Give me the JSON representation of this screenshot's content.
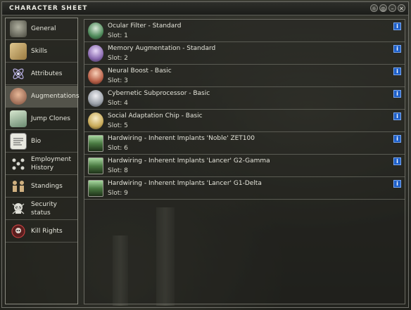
{
  "window": {
    "title": "CHARACTER SHEET",
    "buttons": [
      "☼",
      "◎",
      "–",
      "✕"
    ]
  },
  "sidebar": {
    "items": [
      {
        "label": "General",
        "icon": "portrait-icon"
      },
      {
        "label": "Skills",
        "icon": "scroll-icon"
      },
      {
        "label": "Attributes",
        "icon": "atom-icon"
      },
      {
        "label": "Augmentations",
        "icon": "implant-head-icon",
        "selected": true
      },
      {
        "label": "Jump Clones",
        "icon": "clone-pod-icon"
      },
      {
        "label": "Bio",
        "icon": "document-icon"
      },
      {
        "label": "Employment History",
        "icon": "corporation-icon"
      },
      {
        "label": "Standings",
        "icon": "standings-icon"
      },
      {
        "label": "Security status",
        "icon": "security-skull-icon"
      },
      {
        "label": "Kill Rights",
        "icon": "kill-rights-icon"
      }
    ]
  },
  "implants": [
    {
      "name": "Ocular Filter - Standard",
      "slot": "Slot: 1",
      "icon": "green-head-icon",
      "color": "#4e8a5a"
    },
    {
      "name": "Memory Augmentation - Standard",
      "slot": "Slot: 2",
      "icon": "purple-head-icon",
      "color": "#8a6ab0"
    },
    {
      "name": "Neural Boost - Basic",
      "slot": "Slot: 3",
      "icon": "red-head-icon",
      "color": "#b86048"
    },
    {
      "name": "Cybernetic Subprocessor - Basic",
      "slot": "Slot: 4",
      "icon": "grey-head-icon",
      "color": "#9aa0a8"
    },
    {
      "name": "Social Adaptation Chip - Basic",
      "slot": "Slot: 5",
      "icon": "gold-head-icon",
      "color": "#c8aa58"
    },
    {
      "name": "Hardwiring - Inherent Implants 'Noble' ZET100",
      "slot": "Slot: 6",
      "icon": "hardwiring-icon",
      "color": "#4a7a42"
    },
    {
      "name": "Hardwiring - Inherent Implants 'Lancer' G2-Gamma",
      "slot": "Slot: 8",
      "icon": "hardwiring-icon",
      "color": "#4a7a42"
    },
    {
      "name": "Hardwiring - Inherent Implants 'Lancer' G1-Delta",
      "slot": "Slot: 9",
      "icon": "hardwiring-icon",
      "color": "#4a7a42"
    }
  ],
  "info_label": "i"
}
